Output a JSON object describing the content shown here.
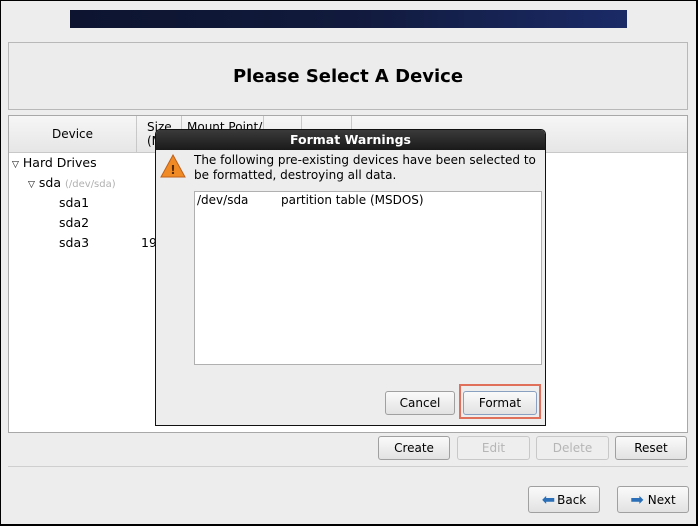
{
  "page": {
    "title": "Please Select A Device"
  },
  "tree": {
    "columns": [
      "Device",
      "Size\n(MB)",
      "Mount Point/\nRAID/Volume",
      "",
      ""
    ],
    "col_visible": [
      "Device",
      "Size",
      "Mount Point/"
    ],
    "col_visible2": [
      "(M"
    ],
    "rows": [
      {
        "label": "Hard Drives",
        "expanded": true
      },
      {
        "label": "sda",
        "sub": "(/dev/sda)",
        "expanded": true
      },
      {
        "label": "sda1",
        "size": ""
      },
      {
        "label": "sda2",
        "size": ""
      },
      {
        "label": "sda3",
        "size": "19"
      }
    ]
  },
  "toolbar": {
    "create": "Create",
    "edit": "Edit",
    "delete": "Delete",
    "reset": "Reset"
  },
  "nav": {
    "back": "Back",
    "next": "Next"
  },
  "dialog": {
    "title": "Format Warnings",
    "icon": "warning-icon",
    "message": "The following pre-existing devices have been selected to be formatted, destroying all data.",
    "items": [
      {
        "device": "/dev/sda",
        "description": "partition table (MSDOS)"
      }
    ],
    "cancel": "Cancel",
    "format": "Format"
  },
  "colors": {
    "highlight": "#e0705a",
    "warning": "#f08a24",
    "arrow": "#2a6fb8"
  }
}
